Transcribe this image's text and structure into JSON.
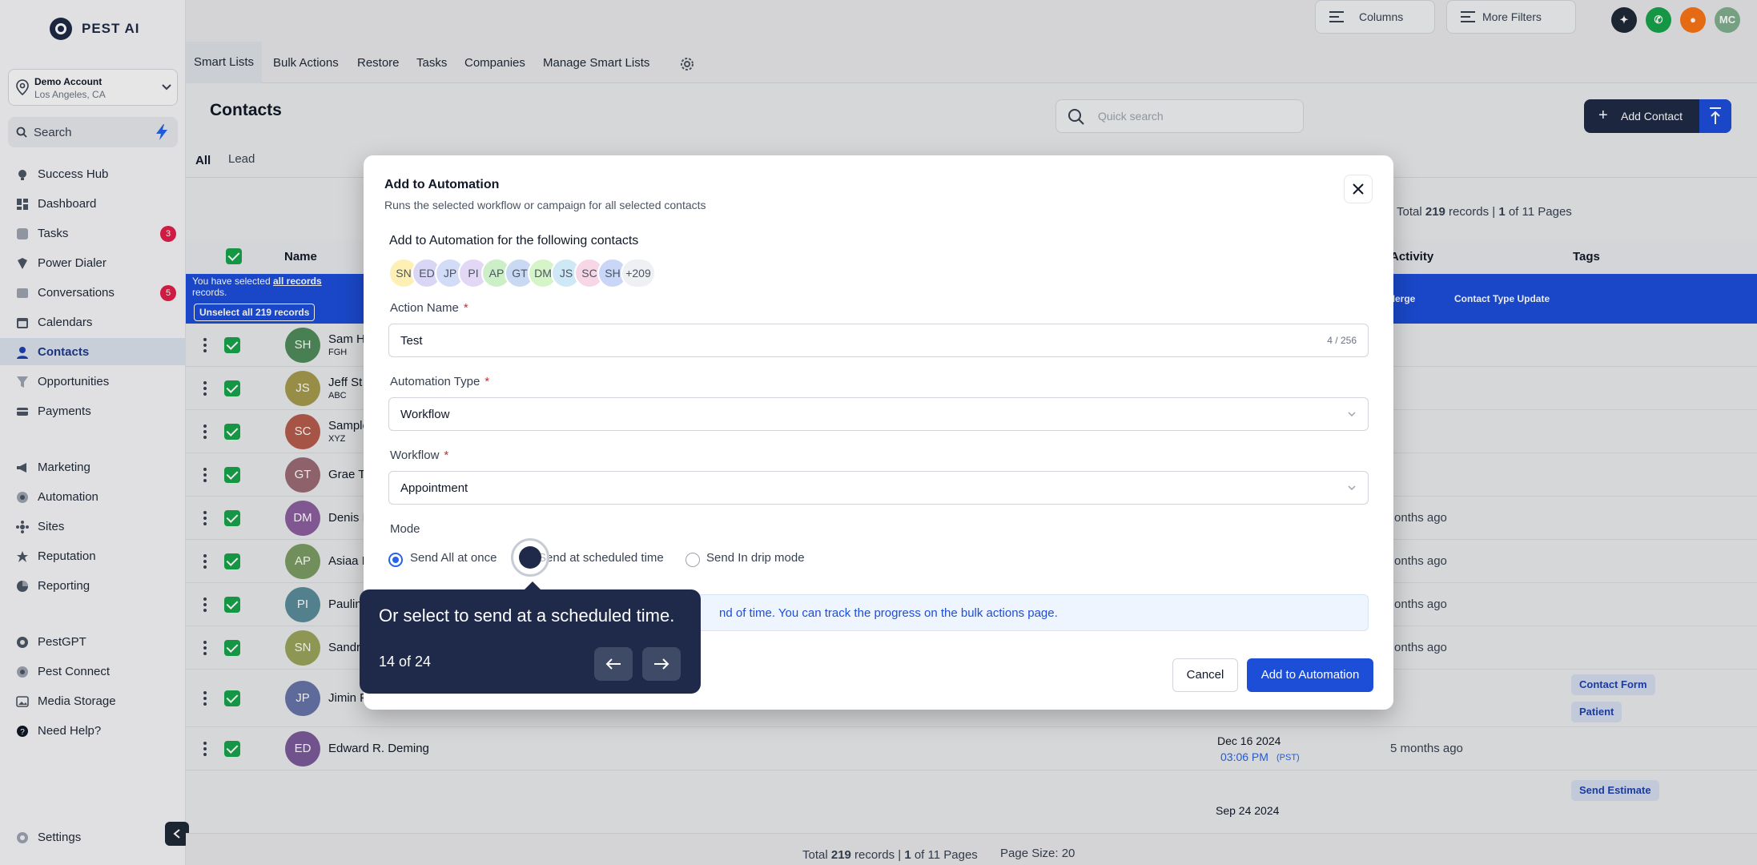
{
  "app": {
    "logo_text": "PEST AI"
  },
  "account": {
    "name": "Demo Account",
    "location": "Los Angeles, CA"
  },
  "sidebar": {
    "search_label": "Search",
    "items": [
      {
        "label": "Success Hub",
        "icon": "trophy-icon"
      },
      {
        "label": "Dashboard",
        "icon": "dashboard-icon"
      },
      {
        "label": "Tasks",
        "icon": "tasks-icon",
        "badge": "3"
      },
      {
        "label": "Power Dialer",
        "icon": "dialer-icon"
      },
      {
        "label": "Conversations",
        "icon": "chat-icon",
        "badge": "5"
      },
      {
        "label": "Calendars",
        "icon": "calendar-icon"
      },
      {
        "label": "Contacts",
        "icon": "contacts-icon",
        "active": true
      },
      {
        "label": "Opportunities",
        "icon": "funnel-icon"
      },
      {
        "label": "Payments",
        "icon": "card-icon"
      },
      {
        "label": "Marketing",
        "icon": "marketing-icon"
      },
      {
        "label": "Automation",
        "icon": "automation-icon"
      },
      {
        "label": "Sites",
        "icon": "sites-icon"
      },
      {
        "label": "Reputation",
        "icon": "star-icon"
      },
      {
        "label": "Reporting",
        "icon": "chart-icon"
      },
      {
        "label": "PestGPT",
        "icon": "pestgpt-icon"
      },
      {
        "label": "Pest Connect",
        "icon": "connect-icon"
      },
      {
        "label": "Media Storage",
        "icon": "media-icon"
      },
      {
        "label": "Need Help?",
        "icon": "help-icon"
      }
    ],
    "settings_label": "Settings"
  },
  "topbar": {
    "user_initials": "MC"
  },
  "tabs": [
    "Smart Lists",
    "Bulk Actions",
    "Restore",
    "Tasks",
    "Companies",
    "Manage Smart Lists"
  ],
  "page": {
    "title": "Contacts",
    "search_placeholder": "Quick search",
    "columns_label": "Columns",
    "filters_label": "More Filters",
    "add_contact_label": "Add Contact",
    "subtabs": [
      "All",
      "Lead"
    ],
    "pager": {
      "total": "219",
      "page": "1",
      "pages": "11",
      "page_size": "Page Size: 20",
      "current": "1"
    }
  },
  "table": {
    "headers": [
      "Name",
      "Activity",
      "Tags"
    ],
    "selected_banner": {
      "prefix": "You have selected",
      "link": "all records",
      "suffix": "records.",
      "unselect": "Unselect all 219 records"
    },
    "bulk_actions": [
      "Merge",
      "Contact Type Update"
    ],
    "rows": [
      {
        "initials": "SH",
        "name": "Sam H",
        "company": "FGH",
        "color": "#4f8a5b",
        "activity": ""
      },
      {
        "initials": "JS",
        "name": "Jeff St",
        "company": "ABC",
        "color": "#a59a4d",
        "activity": ""
      },
      {
        "initials": "SC",
        "name": "Sample",
        "company": "XYZ",
        "color": "#b35c4b",
        "activity": ""
      },
      {
        "initials": "GT",
        "name": "Grae T",
        "company": "",
        "color": "#9b6b73",
        "activity": ""
      },
      {
        "initials": "DM",
        "name": "Denis I",
        "company": "",
        "color": "#8b5f9d",
        "activity": "5 months ago"
      },
      {
        "initials": "AP",
        "name": "Asiaa P",
        "company": "",
        "color": "#7b9c62",
        "activity": "5 months ago"
      },
      {
        "initials": "PI",
        "name": "Pauline",
        "company": "",
        "color": "#5a8b9a",
        "activity": "5 months ago"
      },
      {
        "initials": "SN",
        "name": "Sandra",
        "company": "",
        "color": "#9aa35b",
        "activity": "5 months ago"
      },
      {
        "initials": "JP",
        "name": "Jimin P",
        "company": "",
        "color": "#6573a8",
        "activity": ""
      },
      {
        "initials": "ED",
        "name": "Edward R. Deming",
        "company": "",
        "color": "#7a5a9a",
        "activity": "5 months ago",
        "date": "Dec 16 2024",
        "time": "03:06 PM",
        "tz": "(PST)"
      }
    ],
    "tags": [
      "Contact Form",
      "Patient",
      "Send Estimate"
    ],
    "last_date": "Sep 24 2024"
  },
  "modal": {
    "title": "Add to Automation",
    "subtitle": "Runs the selected workflow or campaign for all selected contacts",
    "heading": "Add to Automation for the following contacts",
    "contacts": [
      {
        "initials": "SN",
        "bg": "#fdf0b5"
      },
      {
        "initials": "ED",
        "bg": "#d9d6f5"
      },
      {
        "initials": "JP",
        "bg": "#d3dcf7"
      },
      {
        "initials": "PI",
        "bg": "#e2d8f5"
      },
      {
        "initials": "AP",
        "bg": "#cdefc7"
      },
      {
        "initials": "GT",
        "bg": "#c9d8f3"
      },
      {
        "initials": "DM",
        "bg": "#d5f5c8"
      },
      {
        "initials": "JS",
        "bg": "#cfe8f6"
      },
      {
        "initials": "SC",
        "bg": "#f7d6e5"
      },
      {
        "initials": "SH",
        "bg": "#c9d6f7"
      },
      {
        "initials": "+209",
        "bg": "#eef0f4"
      }
    ],
    "action_name_label": "Action Name",
    "action_name_value": "Test",
    "action_name_count": "4 / 256",
    "automation_type_label": "Automation Type",
    "automation_type_value": "Workflow",
    "workflow_label": "Workflow",
    "workflow_value": "Appointment",
    "mode_label": "Mode",
    "modes": [
      "Send All at once",
      "Send at scheduled time",
      "Send In drip mode"
    ],
    "info_text": "nd of time. You can track the progress on the bulk actions page.",
    "cancel_label": "Cancel",
    "submit_label": "Add to Automation"
  },
  "tooltip": {
    "text": "Or select to send at a scheduled time.",
    "step": "14 of 24"
  }
}
